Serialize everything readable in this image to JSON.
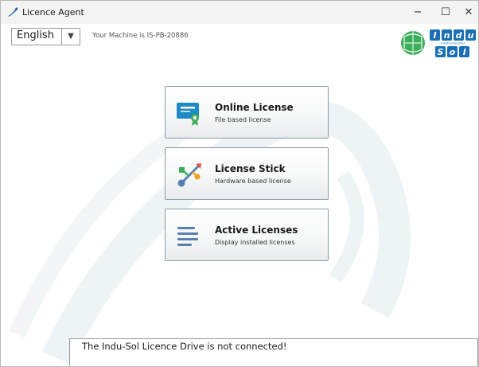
{
  "window": {
    "title": "Licence Agent",
    "controls": {
      "minimize": "−",
      "maximize": "☐",
      "close": "✕"
    }
  },
  "header": {
    "language": {
      "selected": "English",
      "arrow": "▼"
    },
    "machine_label": "Your Machine is IS-PB-20886",
    "logo": {
      "name": "indu-sol-logo",
      "letters_top": [
        "I",
        "n",
        "d",
        "u"
      ],
      "letters_bottom": [
        "S",
        "o",
        "l"
      ],
      "tagline": "Industrial-Solutions"
    }
  },
  "tiles": [
    {
      "title": "Online License",
      "subtitle": "File based license",
      "icon": "certificate-icon"
    },
    {
      "title": "License Stick",
      "subtitle": "Hardware based license",
      "icon": "usb-icon"
    },
    {
      "title": "Active Licenses",
      "subtitle": "Display installed licenses",
      "icon": "list-icon"
    }
  ],
  "status": {
    "message": "The Indu-Sol Licence Drive is not connected!"
  },
  "colors": {
    "accent": "#1f8bc4",
    "tile_border": "#8a9aa6",
    "logo_blue": "#1a6fb5",
    "logo_green": "#3dae5c"
  }
}
